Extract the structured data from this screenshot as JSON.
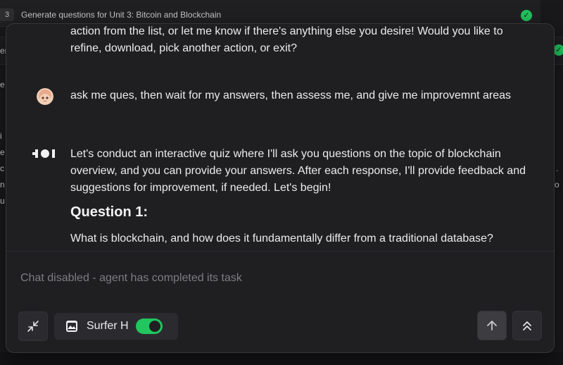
{
  "background": {
    "step_number": "3",
    "step_title": "Generate questions for Unit 3: Bitcoin and Blockchain",
    "left_fragments": [
      "er",
      "e",
      "i",
      "e",
      "c",
      "n",
      "u"
    ],
    "right_fragments": [
      ".",
      "o"
    ]
  },
  "messages": {
    "partial_agent_text": "action from the list, or let me know if there's anything else you desire! Would you like to refine, download, pick another action, or exit?",
    "user_text": "ask me ques, then wait for my answers, then assess me, and give me improvemnt areas",
    "agent_intro": "Let's conduct an interactive quiz where I'll ask you questions on the topic of blockchain overview, and you can provide your answers. After each response, I'll provide feedback and suggestions for improvement, if needed. Let's begin!",
    "question_heading": "Question 1:",
    "question_text": "What is blockchain, and how does it fundamentally differ from a traditional database?"
  },
  "chat": {
    "placeholder": "Chat disabled - agent has completed its task"
  },
  "controls": {
    "agent_name": "Surfer H",
    "agent_toggle_on": true
  },
  "colors": {
    "accent_green": "#22c55e",
    "modal_bg": "#1f1f22",
    "page_bg": "#19191b"
  },
  "icons": {
    "collapse": "collapse-arrows-icon",
    "agent_chip": "image-window-icon",
    "send": "arrow-up-icon",
    "scroll_top": "double-chevron-up-icon",
    "step_done": "check-circle-icon",
    "agent_logo": "agent-logo-icon",
    "user_avatar": "user-avatar"
  }
}
